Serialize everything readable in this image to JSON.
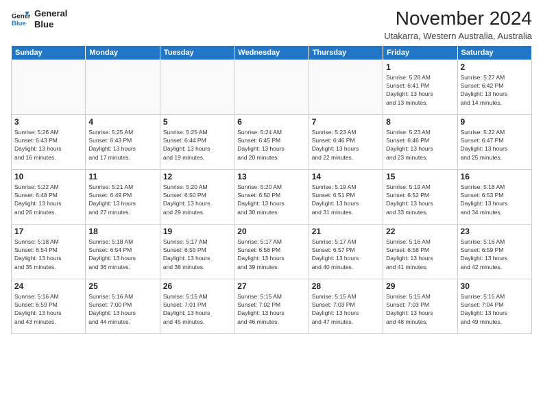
{
  "logo": {
    "line1": "General",
    "line2": "Blue"
  },
  "title": "November 2024",
  "location": "Utakarra, Western Australia, Australia",
  "weekdays": [
    "Sunday",
    "Monday",
    "Tuesday",
    "Wednesday",
    "Thursday",
    "Friday",
    "Saturday"
  ],
  "weeks": [
    [
      {
        "day": "",
        "info": ""
      },
      {
        "day": "",
        "info": ""
      },
      {
        "day": "",
        "info": ""
      },
      {
        "day": "",
        "info": ""
      },
      {
        "day": "",
        "info": ""
      },
      {
        "day": "1",
        "info": "Sunrise: 5:28 AM\nSunset: 6:41 PM\nDaylight: 13 hours\nand 13 minutes."
      },
      {
        "day": "2",
        "info": "Sunrise: 5:27 AM\nSunset: 6:42 PM\nDaylight: 13 hours\nand 14 minutes."
      }
    ],
    [
      {
        "day": "3",
        "info": "Sunrise: 5:26 AM\nSunset: 6:43 PM\nDaylight: 13 hours\nand 16 minutes."
      },
      {
        "day": "4",
        "info": "Sunrise: 5:25 AM\nSunset: 6:43 PM\nDaylight: 13 hours\nand 17 minutes."
      },
      {
        "day": "5",
        "info": "Sunrise: 5:25 AM\nSunset: 6:44 PM\nDaylight: 13 hours\nand 19 minutes."
      },
      {
        "day": "6",
        "info": "Sunrise: 5:24 AM\nSunset: 6:45 PM\nDaylight: 13 hours\nand 20 minutes."
      },
      {
        "day": "7",
        "info": "Sunrise: 5:23 AM\nSunset: 6:46 PM\nDaylight: 13 hours\nand 22 minutes."
      },
      {
        "day": "8",
        "info": "Sunrise: 5:23 AM\nSunset: 6:46 PM\nDaylight: 13 hours\nand 23 minutes."
      },
      {
        "day": "9",
        "info": "Sunrise: 5:22 AM\nSunset: 6:47 PM\nDaylight: 13 hours\nand 25 minutes."
      }
    ],
    [
      {
        "day": "10",
        "info": "Sunrise: 5:22 AM\nSunset: 6:48 PM\nDaylight: 13 hours\nand 26 minutes."
      },
      {
        "day": "11",
        "info": "Sunrise: 5:21 AM\nSunset: 6:49 PM\nDaylight: 13 hours\nand 27 minutes."
      },
      {
        "day": "12",
        "info": "Sunrise: 5:20 AM\nSunset: 6:50 PM\nDaylight: 13 hours\nand 29 minutes."
      },
      {
        "day": "13",
        "info": "Sunrise: 5:20 AM\nSunset: 6:50 PM\nDaylight: 13 hours\nand 30 minutes."
      },
      {
        "day": "14",
        "info": "Sunrise: 5:19 AM\nSunset: 6:51 PM\nDaylight: 13 hours\nand 31 minutes."
      },
      {
        "day": "15",
        "info": "Sunrise: 5:19 AM\nSunset: 6:52 PM\nDaylight: 13 hours\nand 33 minutes."
      },
      {
        "day": "16",
        "info": "Sunrise: 5:18 AM\nSunset: 6:53 PM\nDaylight: 13 hours\nand 34 minutes."
      }
    ],
    [
      {
        "day": "17",
        "info": "Sunrise: 5:18 AM\nSunset: 6:54 PM\nDaylight: 13 hours\nand 35 minutes."
      },
      {
        "day": "18",
        "info": "Sunrise: 5:18 AM\nSunset: 6:54 PM\nDaylight: 13 hours\nand 36 minutes."
      },
      {
        "day": "19",
        "info": "Sunrise: 5:17 AM\nSunset: 6:55 PM\nDaylight: 13 hours\nand 38 minutes."
      },
      {
        "day": "20",
        "info": "Sunrise: 5:17 AM\nSunset: 6:56 PM\nDaylight: 13 hours\nand 39 minutes."
      },
      {
        "day": "21",
        "info": "Sunrise: 5:17 AM\nSunset: 6:57 PM\nDaylight: 13 hours\nand 40 minutes."
      },
      {
        "day": "22",
        "info": "Sunrise: 5:16 AM\nSunset: 6:58 PM\nDaylight: 13 hours\nand 41 minutes."
      },
      {
        "day": "23",
        "info": "Sunrise: 5:16 AM\nSunset: 6:59 PM\nDaylight: 13 hours\nand 42 minutes."
      }
    ],
    [
      {
        "day": "24",
        "info": "Sunrise: 5:16 AM\nSunset: 6:59 PM\nDaylight: 13 hours\nand 43 minutes."
      },
      {
        "day": "25",
        "info": "Sunrise: 5:16 AM\nSunset: 7:00 PM\nDaylight: 13 hours\nand 44 minutes."
      },
      {
        "day": "26",
        "info": "Sunrise: 5:15 AM\nSunset: 7:01 PM\nDaylight: 13 hours\nand 45 minutes."
      },
      {
        "day": "27",
        "info": "Sunrise: 5:15 AM\nSunset: 7:02 PM\nDaylight: 13 hours\nand 46 minutes."
      },
      {
        "day": "28",
        "info": "Sunrise: 5:15 AM\nSunset: 7:03 PM\nDaylight: 13 hours\nand 47 minutes."
      },
      {
        "day": "29",
        "info": "Sunrise: 5:15 AM\nSunset: 7:03 PM\nDaylight: 13 hours\nand 48 minutes."
      },
      {
        "day": "30",
        "info": "Sunrise: 5:15 AM\nSunset: 7:04 PM\nDaylight: 13 hours\nand 49 minutes."
      }
    ]
  ]
}
